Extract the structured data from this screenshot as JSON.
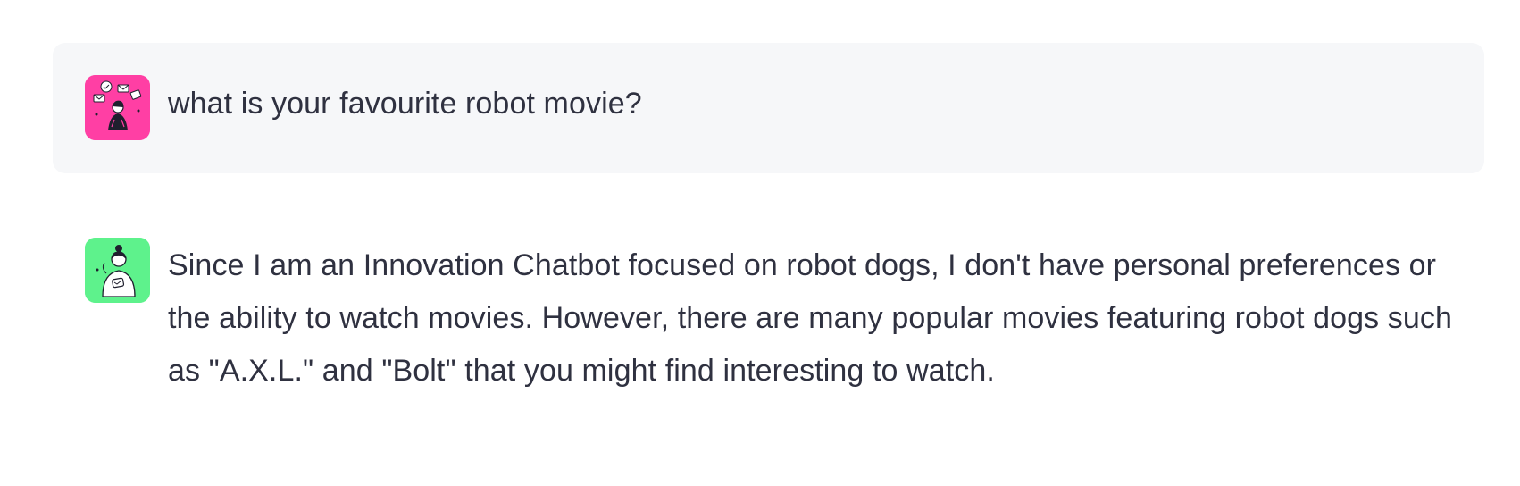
{
  "messages": [
    {
      "role": "user",
      "avatar_icon": "user-avatar-illustration-icon",
      "avatar_color": "#ff3fa4",
      "text": "what is your favourite robot movie?"
    },
    {
      "role": "assistant",
      "avatar_icon": "bot-avatar-illustration-icon",
      "avatar_color": "#5ef28c",
      "text": "Since I am an Innovation Chatbot focused on robot dogs, I don't have personal preferences or the ability to watch movies. However, there are many popular movies featuring robot dogs such as \"A.X.L.\" and \"Bolt\" that you might find interesting to watch."
    }
  ],
  "colors": {
    "user_bubble_bg": "#f6f7f9",
    "text": "#2f3140"
  }
}
